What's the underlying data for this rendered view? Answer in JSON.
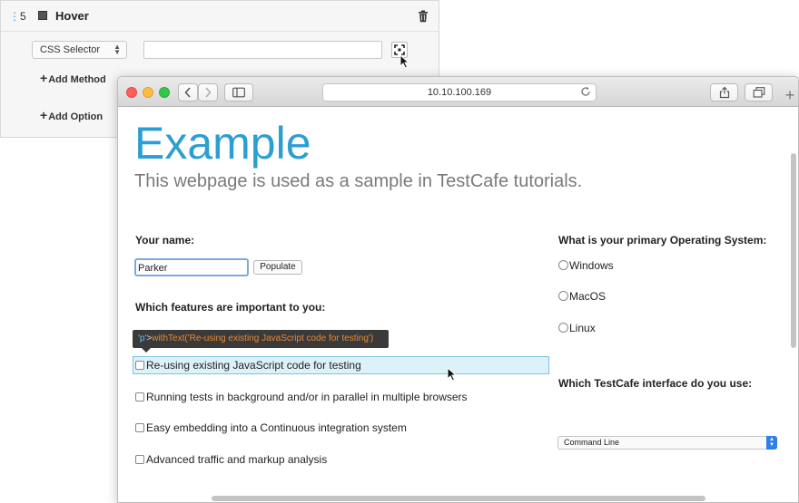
{
  "editor": {
    "step_number": "5",
    "step_name": "Hover",
    "selector_type": "CSS Selector",
    "selector_value": "",
    "add_method": "Add Method",
    "add_option": "Add Option"
  },
  "browser": {
    "url": "10.10.100.169"
  },
  "page": {
    "heading": "Example",
    "subtitle": "This webpage is used as a sample in TestCafe tutorials.",
    "name_label": "Your name:",
    "name_value": "Parker",
    "populate_label": "Populate",
    "features_label": "Which features are important to you:",
    "features": [
      "Re-using existing JavaScript code for testing",
      "Running tests in background and/or in parallel in multiple browsers",
      "Easy embedding into a Continuous integration system",
      "Advanced traffic and markup analysis"
    ],
    "os_label": "What is your primary Operating System:",
    "os_options": [
      "Windows",
      "MacOS",
      "Linux"
    ],
    "interface_label": "Which TestCafe interface do you use:",
    "interface_value": "Command Line"
  },
  "tooltip": {
    "tag": "'p'",
    "arrow": ">",
    "text": "withText('Re-using existing JavaScript code for testing')"
  },
  "colors": {
    "heading": "#2b9fd1",
    "highlight_border": "#7ec2e0",
    "tooltip_bg": "#3a3a3a",
    "tooltip_text": "#e88a35"
  }
}
